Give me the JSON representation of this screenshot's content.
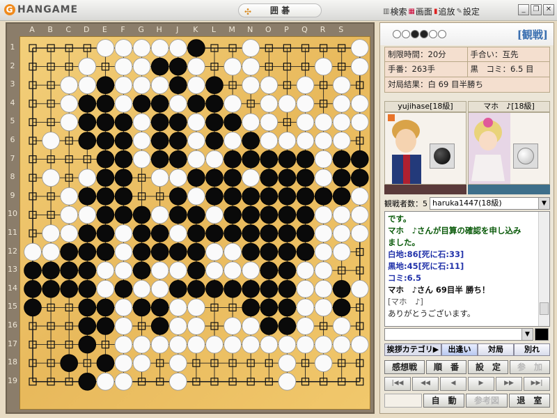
{
  "window": {
    "logo": "HANGAME",
    "game_title": "囲 碁",
    "menu": [
      {
        "label": "検索",
        "icon": "binoculars-icon"
      },
      {
        "label": "画面",
        "icon": "screen-icon"
      },
      {
        "label": "追放",
        "icon": "kick-icon"
      },
      {
        "label": "設定",
        "icon": "wrench-icon"
      }
    ]
  },
  "board": {
    "columns": [
      "A",
      "B",
      "C",
      "D",
      "E",
      "F",
      "G",
      "H",
      "J",
      "K",
      "L",
      "M",
      "N",
      "O",
      "P",
      "Q",
      "R",
      "S"
    ],
    "rows": [
      "1",
      "2",
      "3",
      "4",
      "5",
      "6",
      "7",
      "8",
      "9",
      "10",
      "11",
      "12",
      "13",
      "14",
      "15",
      "16",
      "17",
      "18",
      "19"
    ],
    "stones": [
      "....WWWWWB..W.....W..",
      "...W.WWBBW.WW...W.W",
      "..WWBWWWBWB.WW.W.W.",
      "..WBBWBBWBBW.WWW.WW",
      "..WBBBWBBWBBWW.WWWW",
      ".W.BBBWBBWBWBWWWWW.",
      "....BBWBBWWBBBBBWBB",
      ".W.WBB.WWBBBWBBBWBB",
      "..WBBB..BWBBBBBBBBW",
      "..WWBBBWBBWBBBBBWWW",
      ".WWBBWBBWBBBBBBBWWW",
      "WWBBBWBBBBWWBBBBWW.",
      "BBBBWWBWWBWWWBBWW..",
      "BBBBWBWWBBBBBBBWWBW",
      "B..BBWBBWW..BBBWWB.",
      "...BBW.BWW.WWBBW.W.",
      "...B.WWWWWWWWWWWWWW",
      "..B.BWW.W.....W.W..",
      "...BWW..W.....W...."
    ]
  },
  "header": {
    "watch_label": "[観戦]"
  },
  "info": {
    "time_limit": "制限時間：20分",
    "handicap": "手合い：互先",
    "moves": "手番：263手",
    "komi": "黒　コミ：6.5 目",
    "result": "対局結果：白 69 目半勝ち"
  },
  "players": {
    "black": {
      "name": "yujihase[18級]",
      "color": "#5a3a3a"
    },
    "white": {
      "name": "マホ　♪[18級]",
      "color": "#3e6f8a"
    }
  },
  "spectators": {
    "label": "観戦者数：5",
    "selected": "haruka1447(18級)"
  },
  "chat": [
    {
      "text": "です。",
      "color": "#0a5a0a"
    },
    {
      "text": "マホ　♪さんが目算の確認を申し込み",
      "color": "#0a5a0a"
    },
    {
      "text": "ました。",
      "color": "#0a5a0a"
    },
    {
      "text": "白地:86[死に石:33]",
      "color": "#2233aa"
    },
    {
      "text": "黒地:45[死に石:11]",
      "color": "#2233aa"
    },
    {
      "text": "コミ:6.5",
      "color": "#2233aa"
    },
    {
      "text": "マホ　♪さん 69目半 勝ち！",
      "color": "#111111"
    },
    {
      "text": "[マホ　♪]",
      "color": "#555555"
    },
    {
      "text": "ありがとうございます。",
      "color": "#222222"
    }
  ],
  "greet": {
    "category": "挨拶カテゴリ▶",
    "tabs": [
      "出逢い",
      "対局",
      "別れ"
    ]
  },
  "buttons": {
    "row1": [
      "感想戦",
      "順　番",
      "設　定",
      "参　加"
    ],
    "row2": [
      "自　動",
      "参考図",
      "退　室"
    ]
  }
}
